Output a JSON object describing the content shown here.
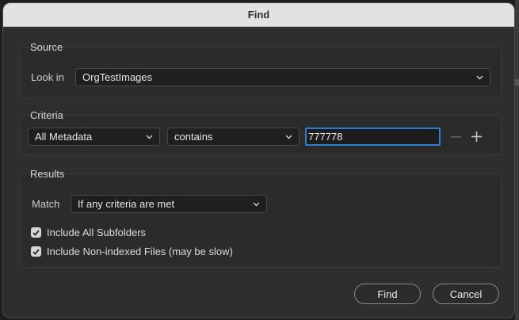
{
  "window": {
    "title": "Find"
  },
  "source": {
    "group_label": "Source",
    "look_in_label": "Look in",
    "look_in_value": "OrgTestImages"
  },
  "criteria": {
    "group_label": "Criteria",
    "field_value": "All Metadata",
    "operator_value": "contains",
    "text_value": "777778",
    "remove_icon": "minus-icon",
    "add_icon": "plus-icon"
  },
  "results": {
    "group_label": "Results",
    "match_label": "Match",
    "match_value": "If any criteria are met",
    "include_subfolders_label": "Include All Subfolders",
    "include_subfolders_checked": true,
    "include_nonindexed_label": "Include Non-indexed Files (may be slow)",
    "include_nonindexed_checked": true
  },
  "buttons": {
    "find_label": "Find",
    "cancel_label": "Cancel"
  },
  "colors": {
    "focus_ring": "#2d7fd4",
    "dialog_bg": "#2e2e2e",
    "titlebar_bg": "#e2e2e2"
  }
}
